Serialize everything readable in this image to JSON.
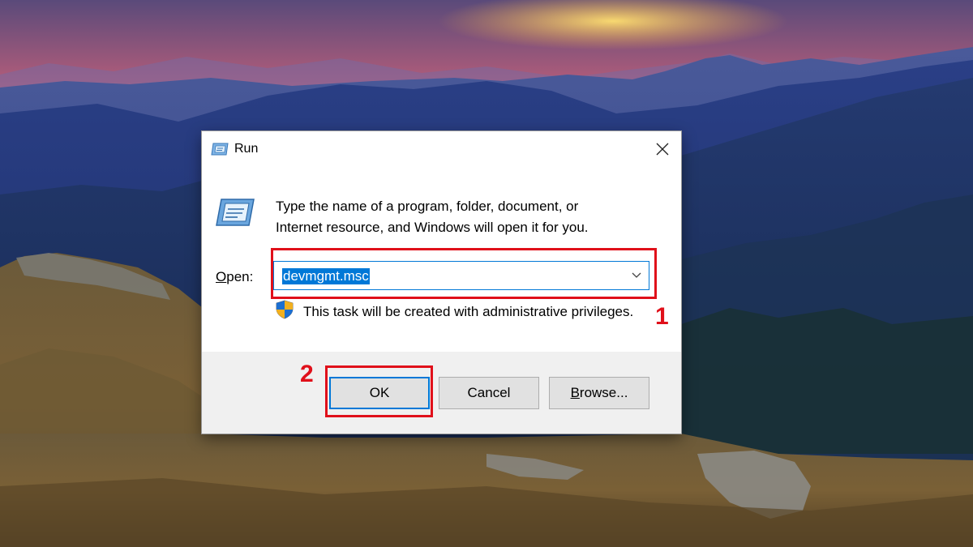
{
  "dialog": {
    "title": "Run",
    "title_icon": "run-icon",
    "close_icon": "close-icon",
    "description_line1": "Type the name of a program, folder, document, or",
    "description_line2": "Internet resource, and Windows will open it for you.",
    "open_label_mnemonic": "O",
    "open_label_rest": "pen:",
    "open_value": "devmgmt.msc",
    "dropdown_icon": "chevron-down-icon",
    "shield_icon": "uac-shield-icon",
    "admin_note": "This task will be created with administrative privileges.",
    "buttons": {
      "ok": "OK",
      "cancel": "Cancel",
      "browse_mnemonic": "B",
      "browse_rest": "rowse..."
    }
  },
  "annotations": {
    "step1": "1",
    "step2": "2",
    "highlight_color": "#e0101a"
  },
  "colors": {
    "accent": "#0078d7",
    "footer_bg": "#f0f0f0",
    "button_bg": "#e1e1e1"
  },
  "wallpaper": "mountain sunset landscape"
}
